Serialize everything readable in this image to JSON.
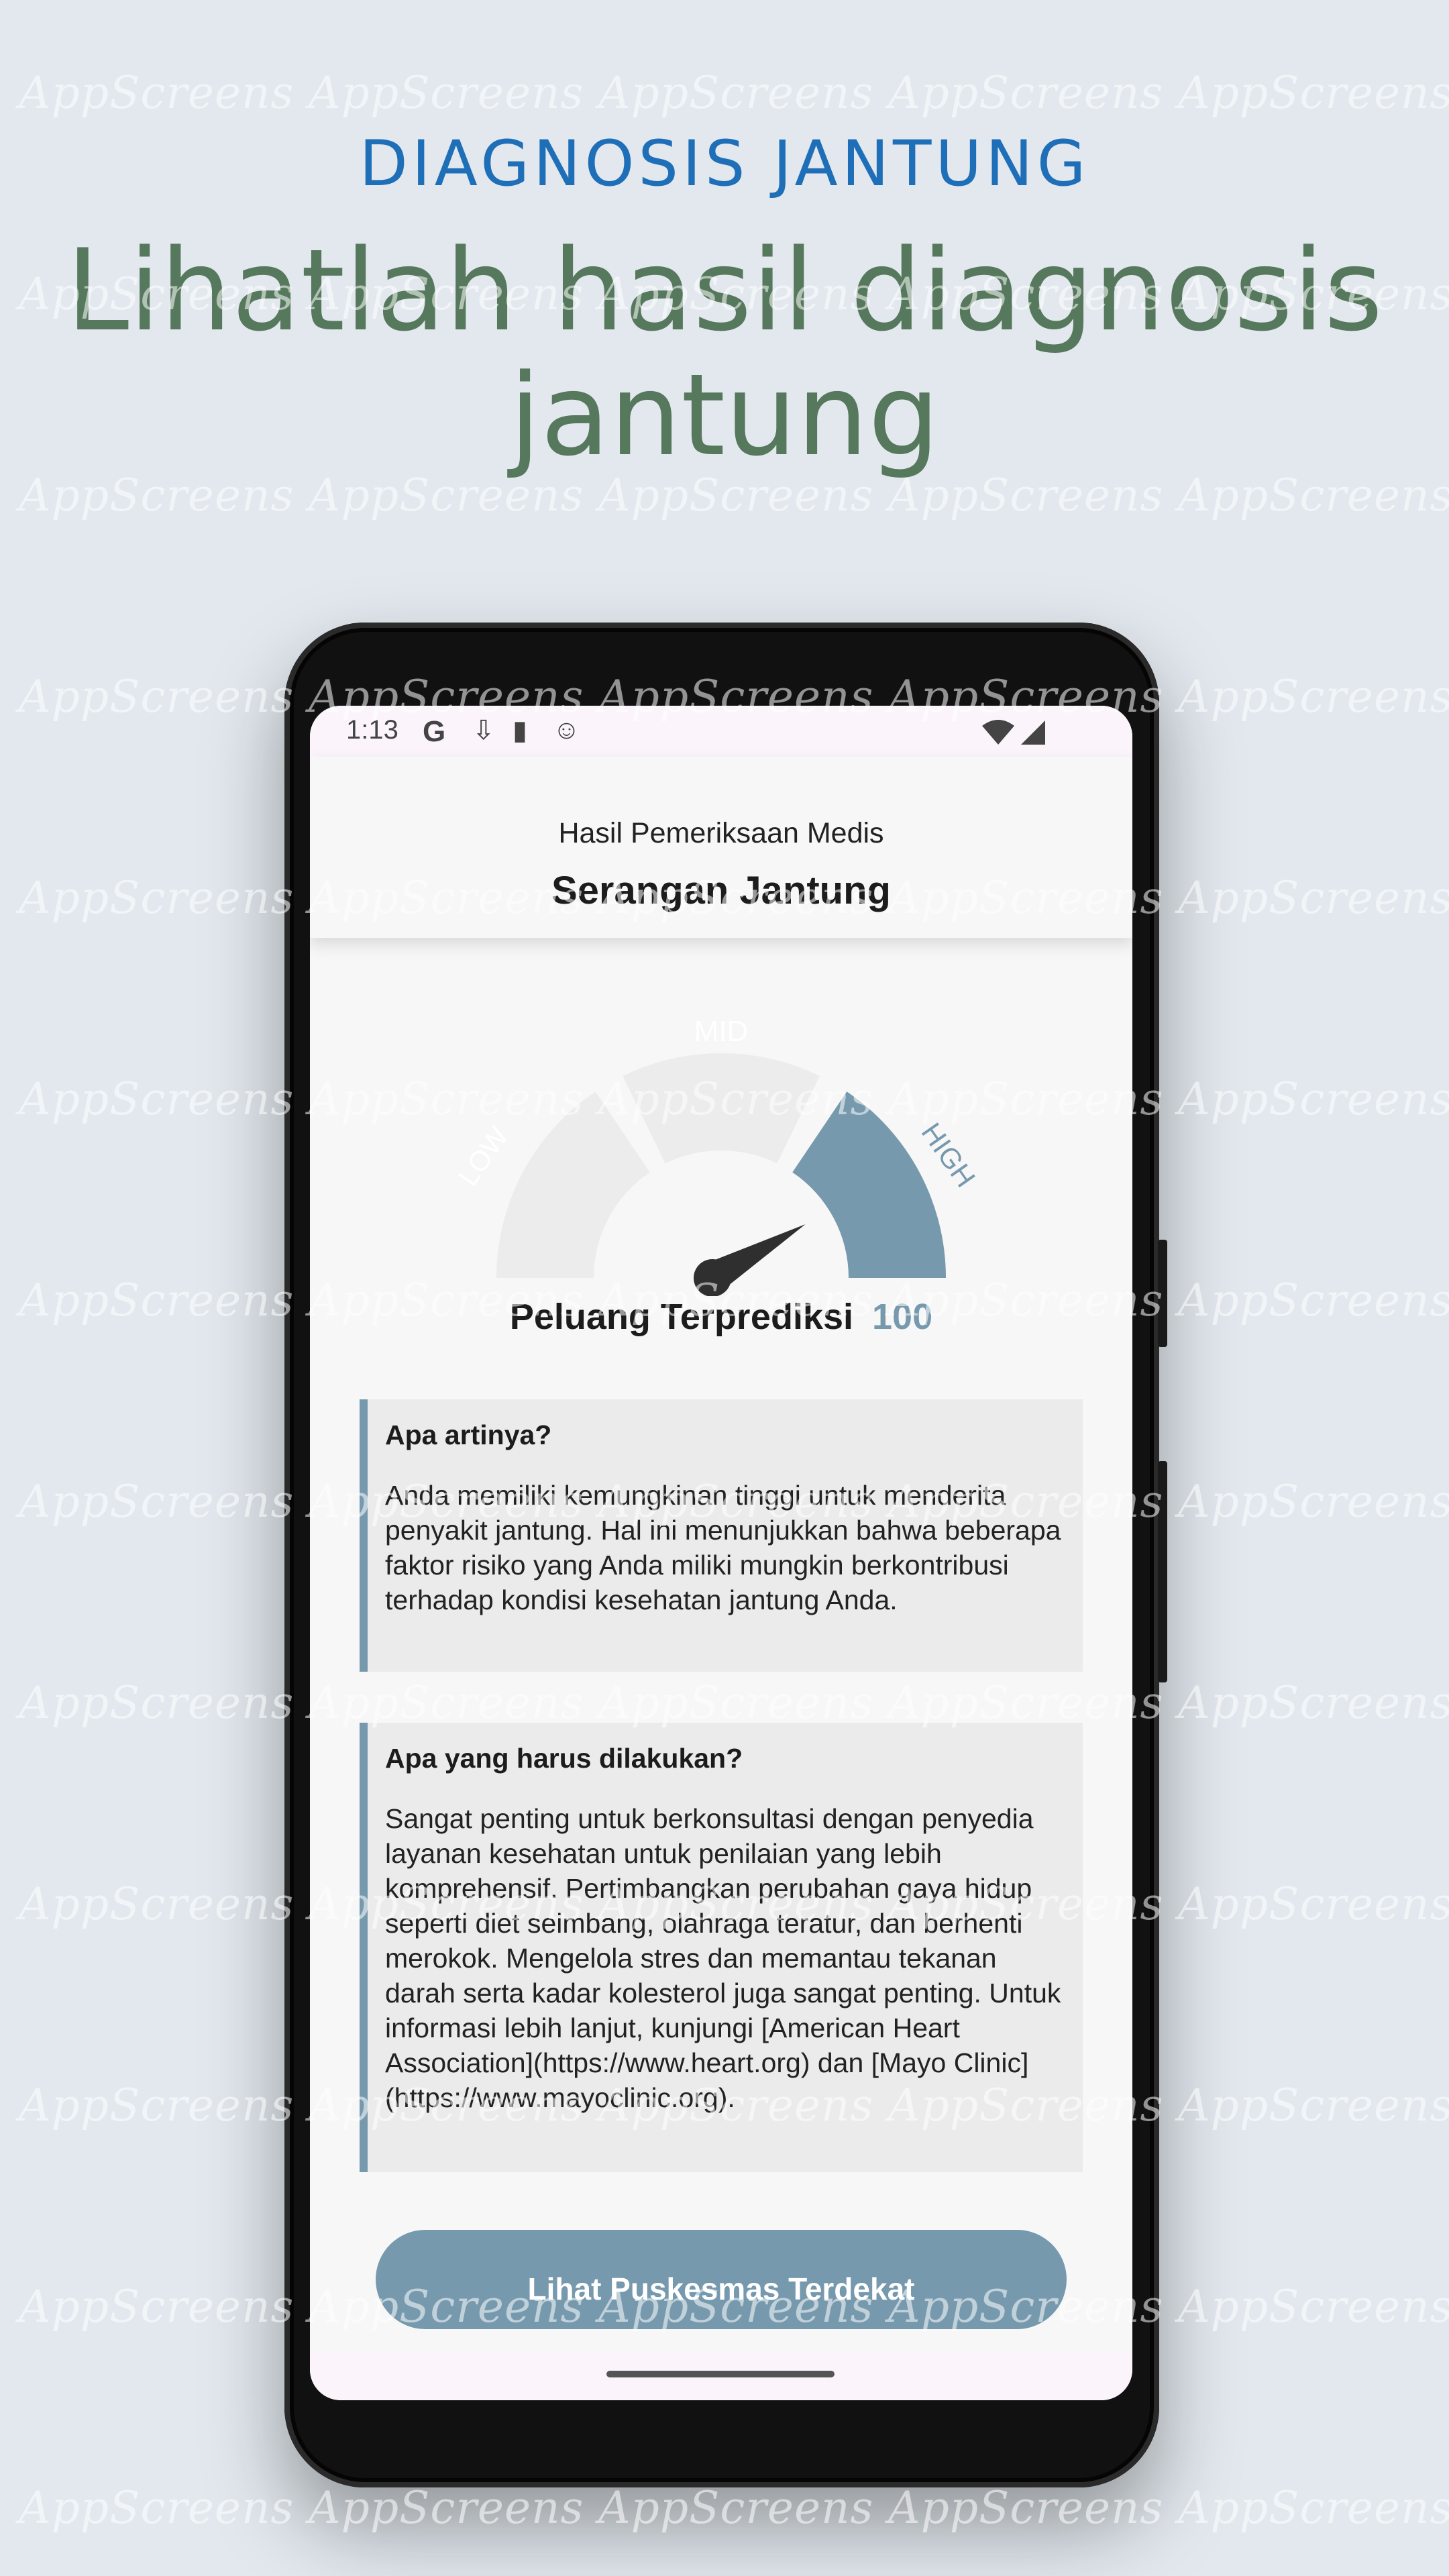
{
  "hero": {
    "kicker": "DIAGNOSIS JANTUNG",
    "title": "Lihatlah hasil diagnosis jantung"
  },
  "watermark": {
    "text": "AppScreens"
  },
  "status_bar": {
    "time": "1:13",
    "icons": [
      "google-icon",
      "download-icon",
      "sd-card-icon",
      "face-icon",
      "wifi-icon",
      "cell-signal-icon"
    ]
  },
  "app_bar": {
    "subtitle": "Hasil Pemeriksaan Medis",
    "title": "Serangan Jantung"
  },
  "gauge": {
    "labels": {
      "low": "LOW",
      "mid": "MID",
      "high": "HIGH"
    },
    "value": 100,
    "active_segment": "high",
    "active_color": "#7699ae",
    "inactive_color": "#ececec"
  },
  "prediction": {
    "label": "Peluang Terprediksi",
    "value": "100"
  },
  "cards": {
    "meaning": {
      "title": "Apa artinya?",
      "body": "Anda memiliki kemungkinan tinggi untuk menderita penyakit jantung. Hal ini menunjukkan bahwa beberapa faktor risiko yang Anda miliki mungkin berkontribusi terhadap kondisi kesehatan jantung Anda."
    },
    "action": {
      "title": "Apa yang harus dilakukan?",
      "body": "Sangat penting untuk berkonsultasi dengan penyedia layanan kesehatan untuk penilaian yang lebih komprehensif. Pertimbangkan perubahan gaya hidup seperti diet seimbang, olahraga teratur, dan berhenti merokok. Mengelola stres dan memantau tekanan darah serta kadar kolesterol juga sangat penting. Untuk informasi lebih lanjut, kunjungi [American Heart Association](https://www.heart.org) dan [Mayo Clinic](https://www.mayoclinic.org)."
    }
  },
  "cta": {
    "label": "Lihat Puskesmas Terdekat"
  },
  "colors": {
    "accent": "#7699ae",
    "hero_kicker": "#1f6fb8",
    "hero_title": "#56785c",
    "background": "#e2e8ee"
  }
}
